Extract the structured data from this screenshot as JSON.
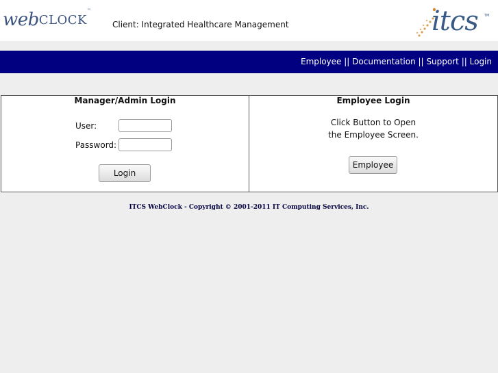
{
  "header": {
    "logo_web": "web",
    "logo_clock": "CLOCK",
    "logo_tm": "™",
    "client_label": "Client: Integrated Healthcare Management",
    "itcs_logo": "itcs",
    "itcs_tm": "TM"
  },
  "nav": {
    "employee": "Employee",
    "documentation": "Documentation",
    "support": "Support",
    "login": "Login",
    "separator": "||"
  },
  "manager": {
    "title": "Manager/Admin Login",
    "user_label": "User:",
    "password_label": "Password:",
    "user_value": "",
    "password_value": "",
    "login_button": "Login"
  },
  "employee": {
    "title": "Employee Login",
    "line1": "Click Button to Open",
    "line2": "the Employee Screen.",
    "button": "Employee"
  },
  "footer": {
    "copyright": "ITCS WebClock - Copyright © 2001-2011 IT Computing Services, Inc."
  },
  "colors": {
    "navbar": "#000080",
    "logo_blue": "#3a5a86",
    "background": "#eeeeee"
  }
}
